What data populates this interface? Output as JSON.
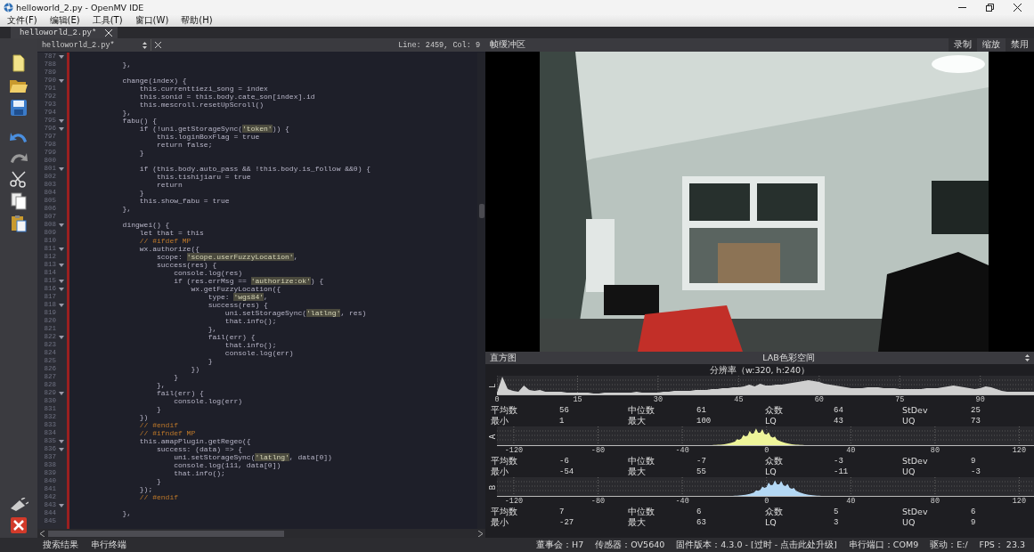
{
  "window": {
    "title": "helloworld_2.py - OpenMV IDE"
  },
  "menu": [
    "文件(F)",
    "编辑(E)",
    "工具(T)",
    "窗口(W)",
    "帮助(H)"
  ],
  "tabs": [
    {
      "label": "helloworld_2.py*",
      "selected": true
    }
  ],
  "editor": {
    "file": "helloworld_2.py*",
    "position": "Line: 2459, Col: 9",
    "lines": [
      {
        "num": "787",
        "fold": true
      },
      {
        "num": "788",
        "code": "            },",
        "fold": false
      },
      {
        "num": "789",
        "fold": false
      },
      {
        "num": "790",
        "code": "            change(index) {",
        "fold": true
      },
      {
        "num": "791",
        "code": "                this.currenttiezi_song = index",
        "fold": false
      },
      {
        "num": "792",
        "code": "                this.sonid = this.body.cate_son[index].id",
        "fold": false
      },
      {
        "num": "793",
        "code": "                this.mescroll.resetUpScroll()",
        "fold": false
      },
      {
        "num": "794",
        "code": "            },",
        "fold": false
      },
      {
        "num": "795",
        "code": "            fabu() {",
        "fold": true
      },
      {
        "num": "796",
        "code": "                if (!uni.getStorageSync('token')) {",
        "fold": true
      },
      {
        "num": "797",
        "code": "                    this.loginBoxFlag = true",
        "fold": false
      },
      {
        "num": "798",
        "code": "                    return false;",
        "fold": false
      },
      {
        "num": "799",
        "code": "                }",
        "fold": false
      },
      {
        "num": "800",
        "fold": false
      },
      {
        "num": "801",
        "code": "                if (this.body.auto_pass && !this.body.is_follow &&0) {",
        "fold": true
      },
      {
        "num": "802",
        "code": "                    this.tishijiaru = true",
        "fold": false
      },
      {
        "num": "803",
        "code": "                    return",
        "fold": false
      },
      {
        "num": "804",
        "code": "                }",
        "fold": false
      },
      {
        "num": "805",
        "code": "                this.show_fabu = true",
        "fold": false
      },
      {
        "num": "806",
        "code": "            },",
        "fold": false
      },
      {
        "num": "807",
        "fold": false
      },
      {
        "num": "808",
        "code": "            dingwei() {",
        "fold": true
      },
      {
        "num": "809",
        "code": "                let that = this",
        "fold": false
      },
      {
        "num": "810",
        "code": "                // #ifdef MP",
        "fold": false
      },
      {
        "num": "811",
        "code": "                wx.authorize({",
        "fold": true
      },
      {
        "num": "812",
        "code": "                    scope: 'scope.userFuzzyLocation',",
        "fold": false
      },
      {
        "num": "813",
        "code": "                    success(res) {",
        "fold": true
      },
      {
        "num": "814",
        "code": "                        console.log(res)",
        "fold": false
      },
      {
        "num": "815",
        "code": "                        if (res.errMsg == 'authorize:ok') {",
        "fold": true
      },
      {
        "num": "816",
        "code": "                            wx.getFuzzyLocation({",
        "fold": true
      },
      {
        "num": "817",
        "code": "                                type: 'wgs84',",
        "fold": false
      },
      {
        "num": "818",
        "code": "                                success(res) {",
        "fold": true
      },
      {
        "num": "819",
        "code": "                                    uni.setStorageSync('latlng', res)",
        "fold": false
      },
      {
        "num": "820",
        "code": "                                    that.info();",
        "fold": false
      },
      {
        "num": "821",
        "code": "                                },",
        "fold": false
      },
      {
        "num": "822",
        "code": "                                fail(err) {",
        "fold": true
      },
      {
        "num": "823",
        "code": "                                    that.info();",
        "fold": false
      },
      {
        "num": "824",
        "code": "                                    console.log(err)",
        "fold": false
      },
      {
        "num": "825",
        "code": "                                }",
        "fold": false
      },
      {
        "num": "826",
        "code": "                            })",
        "fold": false
      },
      {
        "num": "827",
        "code": "                        }",
        "fold": false
      },
      {
        "num": "828",
        "code": "                    },",
        "fold": false
      },
      {
        "num": "829",
        "code": "                    fail(err) {",
        "fold": true
      },
      {
        "num": "830",
        "code": "                        console.log(err)",
        "fold": false
      },
      {
        "num": "831",
        "code": "                    }",
        "fold": false
      },
      {
        "num": "832",
        "code": "                })",
        "fold": false
      },
      {
        "num": "833",
        "code": "                // #endif",
        "fold": false
      },
      {
        "num": "834",
        "code": "                // #ifndef MP",
        "fold": false
      },
      {
        "num": "835",
        "code": "                this.amapPlugin.getRegeo({",
        "fold": true
      },
      {
        "num": "836",
        "code": "                    success: (data) => {",
        "fold": true
      },
      {
        "num": "837",
        "code": "                        uni.setStorageSync('latlng', data[0])",
        "fold": false
      },
      {
        "num": "838",
        "code": "                        console.log(111, data[0])",
        "fold": false
      },
      {
        "num": "839",
        "code": "                        that.info();",
        "fold": false
      },
      {
        "num": "840",
        "code": "                    }",
        "fold": false
      },
      {
        "num": "841",
        "code": "                });",
        "fold": false
      },
      {
        "num": "842",
        "code": "                // #endif",
        "fold": false
      },
      {
        "num": "843",
        "fold": true
      },
      {
        "num": "844",
        "code": "            },",
        "fold": false
      },
      {
        "num": "845",
        "fold": false
      }
    ]
  },
  "frame_buffer": {
    "title": "帧缓冲区",
    "buttons": [
      "录制",
      "缩放",
      "禁用"
    ]
  },
  "histogram": {
    "title": "直方图",
    "color_space": "LAB色彩空间",
    "resolution": "分辨率（w:320, h:240）",
    "channels": [
      {
        "label": "L",
        "color": "#cfcfcf",
        "ticks": [
          "0",
          "15",
          "30",
          "45",
          "60",
          "75",
          "90"
        ],
        "stats": [
          {
            "label": "平均数",
            "value": "56"
          },
          {
            "label": "中位数",
            "value": "61"
          },
          {
            "label": "众数",
            "value": "64"
          },
          {
            "label": "StDev",
            "value": "25"
          },
          {
            "label": "最小",
            "value": "1"
          },
          {
            "label": "最大",
            "value": "100"
          },
          {
            "label": "LQ",
            "value": "43"
          },
          {
            "label": "UQ",
            "value": "73"
          }
        ]
      },
      {
        "label": "A",
        "color": "#eef59a",
        "ticks": [
          "-120",
          "-80",
          "-40",
          "0",
          "40",
          "80",
          "120"
        ],
        "stats": [
          {
            "label": "平均数",
            "value": "-6"
          },
          {
            "label": "中位数",
            "value": "-7"
          },
          {
            "label": "众数",
            "value": "-3"
          },
          {
            "label": "StDev",
            "value": "9"
          },
          {
            "label": "最小",
            "value": "-54"
          },
          {
            "label": "最大",
            "value": "55"
          },
          {
            "label": "LQ",
            "value": "-11"
          },
          {
            "label": "UQ",
            "value": "-3"
          }
        ]
      },
      {
        "label": "B",
        "color": "#b4d8f4",
        "ticks": [
          "-120",
          "-80",
          "-40",
          "0",
          "40",
          "80",
          "120"
        ],
        "stats": [
          {
            "label": "平均数",
            "value": "7"
          },
          {
            "label": "中位数",
            "value": "6"
          },
          {
            "label": "众数",
            "value": "5"
          },
          {
            "label": "StDev",
            "value": "6"
          },
          {
            "label": "最小",
            "value": "-27"
          },
          {
            "label": "最大",
            "value": "63"
          },
          {
            "label": "LQ",
            "value": "3"
          },
          {
            "label": "UQ",
            "value": "9"
          }
        ]
      }
    ]
  },
  "bottom_tabs": [
    "搜索结果",
    "串行终端"
  ],
  "status_bar": [
    "董事会：H7",
    "传感器：OV5640",
    "固件版本：4.3.0 - [过时 - 点击此处升级]",
    "串行端口：COM9",
    "驱动：E:/",
    "FPS：  23.3"
  ]
}
